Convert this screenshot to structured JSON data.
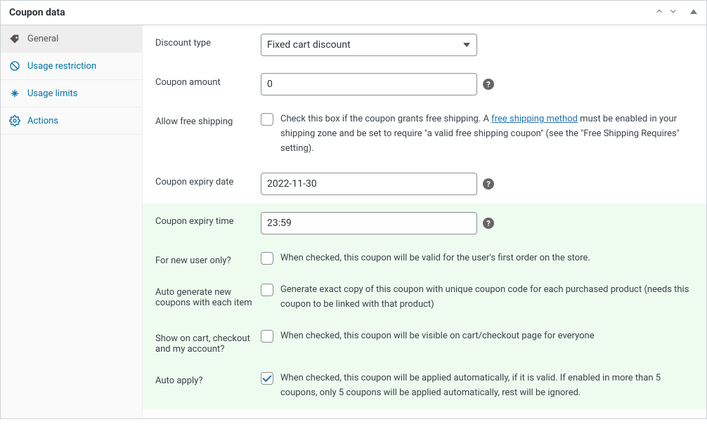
{
  "panel": {
    "title": "Coupon data"
  },
  "sidebar": {
    "items": [
      {
        "label": "General"
      },
      {
        "label": "Usage restriction"
      },
      {
        "label": "Usage limits"
      },
      {
        "label": "Actions"
      }
    ]
  },
  "fields": {
    "discount_type": {
      "label": "Discount type",
      "value": "Fixed cart discount"
    },
    "coupon_amount": {
      "label": "Coupon amount",
      "value": "0"
    },
    "free_shipping": {
      "label": "Allow free shipping",
      "desc_pre": "Check this box if the coupon grants free shipping. A ",
      "link_text": "free shipping method",
      "desc_post": " must be enabled in your shipping zone and be set to require \"a valid free shipping coupon\" (see the \"Free Shipping Requires\" setting)."
    },
    "expiry_date": {
      "label": "Coupon expiry date",
      "value": "2022-11-30"
    },
    "expiry_time": {
      "label": "Coupon expiry time",
      "value": "23:59"
    },
    "new_user": {
      "label": "For new user only?",
      "desc": "When checked, this coupon will be valid for the user's first order on the store."
    },
    "auto_generate": {
      "label": "Auto generate new coupons with each item",
      "desc": "Generate exact copy of this coupon with unique coupon code for each purchased product (needs this coupon to be linked with that product)"
    },
    "show_cart": {
      "label": "Show on cart, checkout and my account?",
      "desc": "When checked, this coupon will be visible on cart/checkout page for everyone"
    },
    "auto_apply": {
      "label": "Auto apply?",
      "desc": "When checked, this coupon will be applied automatically, if it is valid. If enabled in more than 5 coupons, only 5 coupons will be applied automatically, rest will be ignored."
    }
  }
}
